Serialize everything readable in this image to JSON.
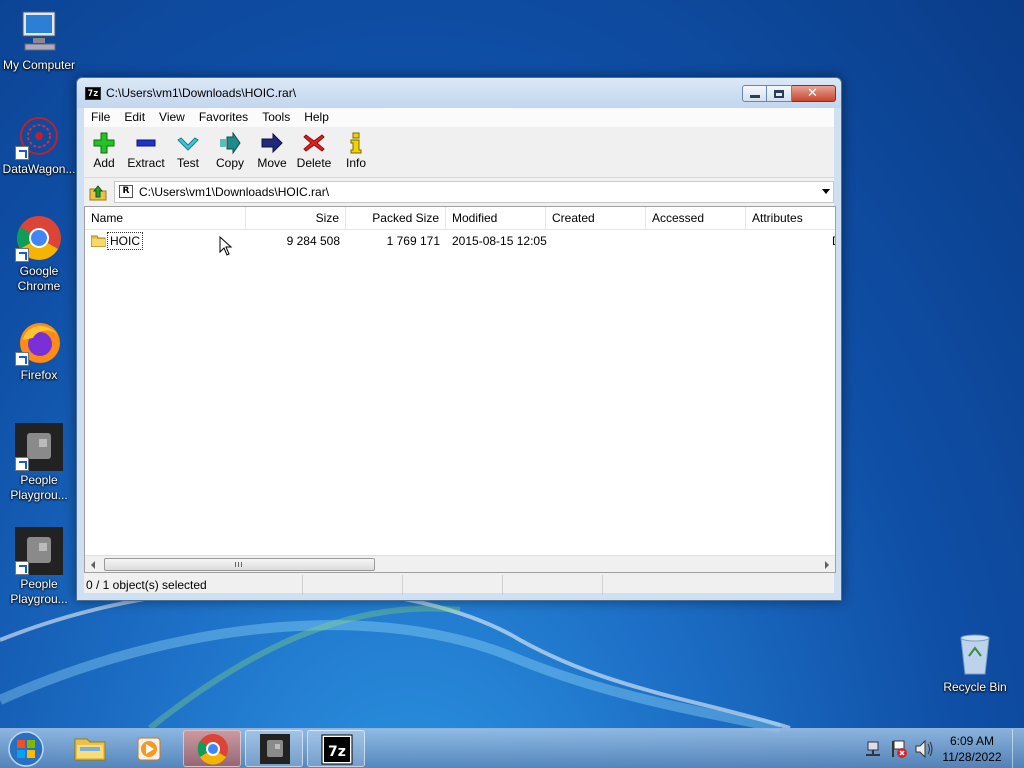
{
  "desktop": {
    "icons": [
      {
        "label": "My Computer"
      },
      {
        "label": "DataWagon..."
      },
      {
        "label": "Google Chrome"
      },
      {
        "label": "Firefox"
      },
      {
        "label": "People Playgrou..."
      },
      {
        "label": "People Playgrou..."
      },
      {
        "label": "Recycle Bin"
      }
    ]
  },
  "window": {
    "title": "C:\\Users\\vm1\\Downloads\\HOIC.rar\\",
    "app_icon": "7z",
    "controls": {
      "close_glyph": "✕"
    }
  },
  "menu": [
    "File",
    "Edit",
    "View",
    "Favorites",
    "Tools",
    "Help"
  ],
  "toolbar": [
    {
      "label": "Add",
      "icon": "plus-icon",
      "color": "#1fb31f"
    },
    {
      "label": "Extract",
      "icon": "minus-icon",
      "color": "#1f2fb3"
    },
    {
      "label": "Test",
      "icon": "check-icon",
      "color": "#22a0b8"
    },
    {
      "label": "Copy",
      "icon": "copy-arrow-icon",
      "color": "#1f8a8a"
    },
    {
      "label": "Move",
      "icon": "move-arrow-icon",
      "color": "#1f2a7a"
    },
    {
      "label": "Delete",
      "icon": "delete-icon",
      "color": "#d62020"
    },
    {
      "label": "Info",
      "icon": "info-icon",
      "color": "#c9a000"
    }
  ],
  "address": {
    "path": "C:\\Users\\vm1\\Downloads\\HOIC.rar\\",
    "icon_letter": "R"
  },
  "list": {
    "columns": [
      "Name",
      "Size",
      "Packed Size",
      "Modified",
      "Created",
      "Accessed",
      "Attributes"
    ],
    "rows": [
      {
        "name": "HOIC",
        "size": "9 284 508",
        "packed": "1 769 171",
        "modified": "2015-08-15 12:05",
        "created": "",
        "accessed": "",
        "attributes": "D"
      }
    ]
  },
  "status": {
    "selection": "0 / 1 object(s) selected"
  },
  "taskbar": {
    "clock_time": "6:09 AM",
    "clock_date": "11/28/2022",
    "items": [
      "Windows Explorer",
      "Media Player",
      "Google Chrome",
      "People Playground",
      "7-Zip"
    ]
  }
}
